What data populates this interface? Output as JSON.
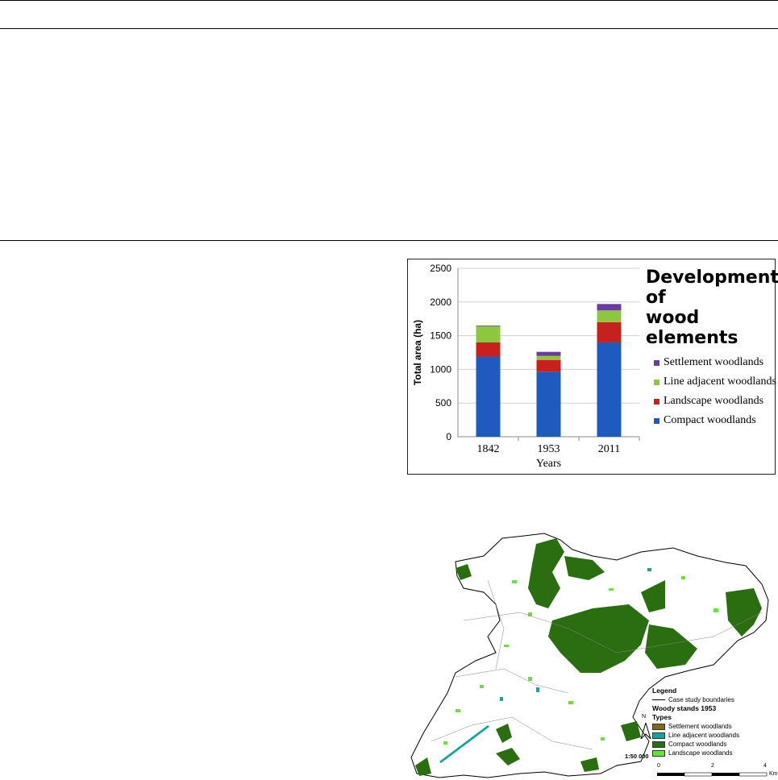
{
  "chart": {
    "title_line1": "Development of",
    "title_line2": "wood elements",
    "legend": [
      {
        "label": "Settlement woodlands",
        "color": "#6a3d9a"
      },
      {
        "label": "Line adjacent woodlands",
        "color": "#8dc63f"
      },
      {
        "label": "Landscape woodlands",
        "color": "#c8201e"
      },
      {
        "label": "Compact woodlands",
        "color": "#1f5bbf"
      }
    ]
  },
  "chart_data": {
    "type": "bar",
    "stacked": true,
    "categories": [
      "1842",
      "1953",
      "2011"
    ],
    "series": [
      {
        "name": "Compact woodlands",
        "values": [
          1190,
          965,
          1400
        ],
        "color": "#1f5bbf"
      },
      {
        "name": "Landscape woodlands",
        "values": [
          210,
          175,
          300
        ],
        "color": "#c8201e"
      },
      {
        "name": "Line adjacent woodlands",
        "values": [
          240,
          60,
          175
        ],
        "color": "#8dc63f"
      },
      {
        "name": "Settlement woodlands",
        "values": [
          10,
          60,
          95
        ],
        "color": "#6a3d9a"
      }
    ],
    "title": "Development of wood elements",
    "xlabel": "Years",
    "ylabel": "Total area (ha)",
    "ylim": [
      0,
      2500
    ],
    "yticks": [
      "0",
      "500",
      "1000",
      "1500",
      "2000",
      "2500"
    ],
    "grid": true,
    "legend_position": "right"
  },
  "map": {
    "legend_title": "Legend",
    "boundary_label": "Case study boundaries",
    "layer_title": "Woody stands 1953",
    "types_label": "Types",
    "items": [
      {
        "label": "Settlement woodlands",
        "color": "#7a6a1a"
      },
      {
        "label": "Line adjacent woodlands",
        "color": "#1aa39a"
      },
      {
        "label": "Compact woodlands",
        "color": "#2b6e12"
      },
      {
        "label": "Landscape woodlands",
        "color": "#66e23a"
      }
    ],
    "north_label": "N",
    "scale_text": "1:50 000",
    "scale_ticks": [
      "0",
      "2",
      "4"
    ],
    "scale_unit": "Km"
  }
}
